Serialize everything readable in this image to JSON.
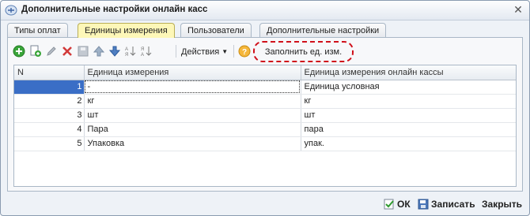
{
  "window": {
    "title": "Дополнительные настройки онлайн касс"
  },
  "tabs": [
    {
      "label": "Типы оплат",
      "active": false
    },
    {
      "label": "Единицы измерения",
      "active": true
    },
    {
      "label": "Пользователи",
      "active": false
    },
    {
      "label": "Дополнительные настройки",
      "active": false
    }
  ],
  "toolbar": {
    "add_icon": "add-icon",
    "copy_icon": "copy-icon",
    "edit_icon": "edit-icon",
    "delete_icon": "delete-icon",
    "save_icon": "save-icon",
    "move_up_icon": "arrow-up-icon",
    "move_down_icon": "arrow-down-icon",
    "sort_asc_icon": "sort-asc-icon",
    "sort_desc_icon": "sort-desc-icon",
    "actions_label": "Действия",
    "help_icon": "help-icon",
    "fill_label": "Заполнить ед. изм."
  },
  "table": {
    "columns": [
      "N",
      "Единица измерения",
      "Единица измерения онлайн кассы"
    ],
    "rows": [
      {
        "n": "1",
        "unit": "-",
        "online_unit": "Единица условная"
      },
      {
        "n": "2",
        "unit": "кг",
        "online_unit": "кг"
      },
      {
        "n": "3",
        "unit": "шт",
        "online_unit": "шт"
      },
      {
        "n": "4",
        "unit": "Пара",
        "online_unit": "пара"
      },
      {
        "n": "5",
        "unit": "Упаковка",
        "online_unit": "упак."
      }
    ]
  },
  "footer": {
    "ok_label": "ОК",
    "save_label": "Записать",
    "close_label": "Закрыть"
  },
  "colors": {
    "accent_red": "#d0101a",
    "active_tab": "#fdf7b8",
    "selection": "#3a6ec6"
  }
}
